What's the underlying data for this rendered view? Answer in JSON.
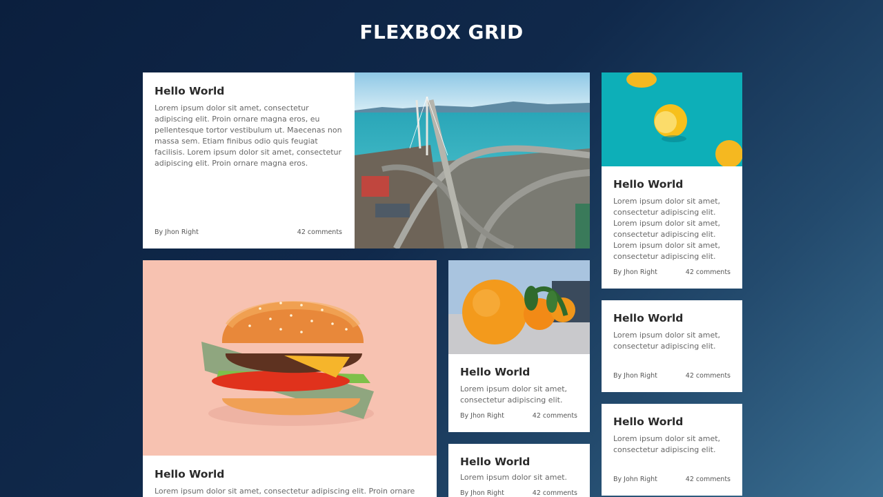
{
  "page": {
    "title": "FLEXBOX GRID"
  },
  "cards": {
    "c1": {
      "title": "Hello World",
      "text": "Lorem ipsum dolor sit amet, consectetur adipiscing elit. Proin ornare magna eros, eu pellentesque tortor vestibulum ut. Maecenas non massa sem. Etiam finibus odio quis feugiat facilisis. Lorem ipsum dolor sit amet, consectetur adipiscing elit. Proin ornare magna eros.",
      "author": "By Jhon Right",
      "comments": "42 comments",
      "image": "bridge-city-photo"
    },
    "c2": {
      "title": "Hello World",
      "text": "Lorem ipsum dolor sit amet, consectetur adipiscing elit. Lorem ipsum dolor sit amet, consectetur adipiscing elit. Lorem ipsum dolor sit amet, consectetur adipiscing elit.",
      "author": "By Jhon Right",
      "comments": "42 comments",
      "image": "lemons-photo"
    },
    "c3": {
      "title": "Hello World",
      "text": "Lorem ipsum dolor sit amet, consectetur adipiscing elit. Proin ornare magna",
      "image": "burger-photo"
    },
    "c4": {
      "title": "Hello World",
      "text": "Lorem ipsum dolor sit amet, consectetur adipiscing elit.",
      "author": "By Jhon Right",
      "comments": "42 comments",
      "image": "oranges-photo"
    },
    "c5": {
      "title": "Hello World",
      "text": "Lorem ipsum dolor sit amet, consectetur adipiscing elit.",
      "author": "By Jhon Right",
      "comments": "42 comments"
    },
    "c6": {
      "title": "Hello World",
      "text": "Lorem ipsum dolor sit amet.",
      "author": "By Jhon Right",
      "comments": "42 comments"
    },
    "c7": {
      "title": "Hello World",
      "text": "Lorem ipsum dolor sit amet, consectetur adipiscing elit.",
      "author": "By John Right",
      "comments": "42 comments"
    }
  },
  "colors": {
    "background_top": "#0b1f3e",
    "background_bottom": "#3a6f92",
    "card": "#ffffff",
    "title_text": "#2a2a2a",
    "body_text": "#666666"
  }
}
